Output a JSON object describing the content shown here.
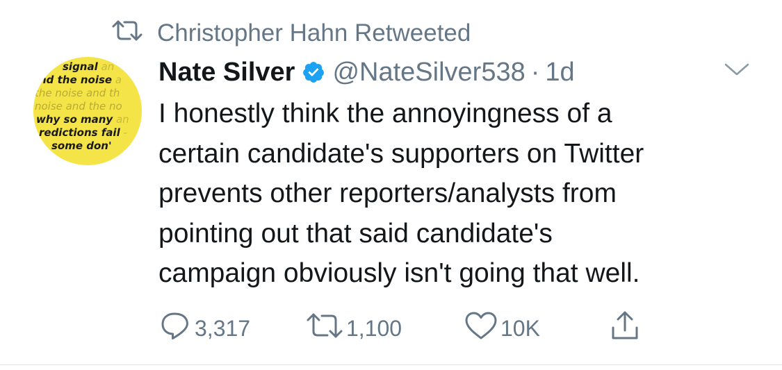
{
  "social_context": {
    "text": "Christopher Hahn Retweeted"
  },
  "avatar": {
    "lines": [
      {
        "main": "signal",
        "trail": " an"
      },
      {
        "main": "nd the noise",
        "trail": " a"
      },
      {
        "main": "the noise and th",
        "trail": ""
      },
      {
        "main": "noise and the no",
        "trail": ""
      },
      {
        "main": "why so many",
        "trail": " an"
      },
      {
        "main": "redictions fail",
        "trail": " -"
      },
      {
        "main": "some don'",
        "trail": ""
      }
    ]
  },
  "tweet": {
    "author_name": "Nate Silver",
    "handle": "@NateSilver538",
    "separator": "·",
    "time": "1d",
    "text_lines": [
      "I honestly think the annoyingness of a",
      "certain candidate's supporters on Twitter",
      "prevents other reporters/analysts from",
      "pointing out that said candidate's",
      "campaign obviously isn't going that well."
    ]
  },
  "actions": {
    "replies": "3,317",
    "retweets": "1,100",
    "likes": "10K"
  },
  "colors": {
    "text": "#14171a",
    "secondary": "#657786",
    "verified": "#1da1f2",
    "avatar_bg": "#f5e447"
  }
}
